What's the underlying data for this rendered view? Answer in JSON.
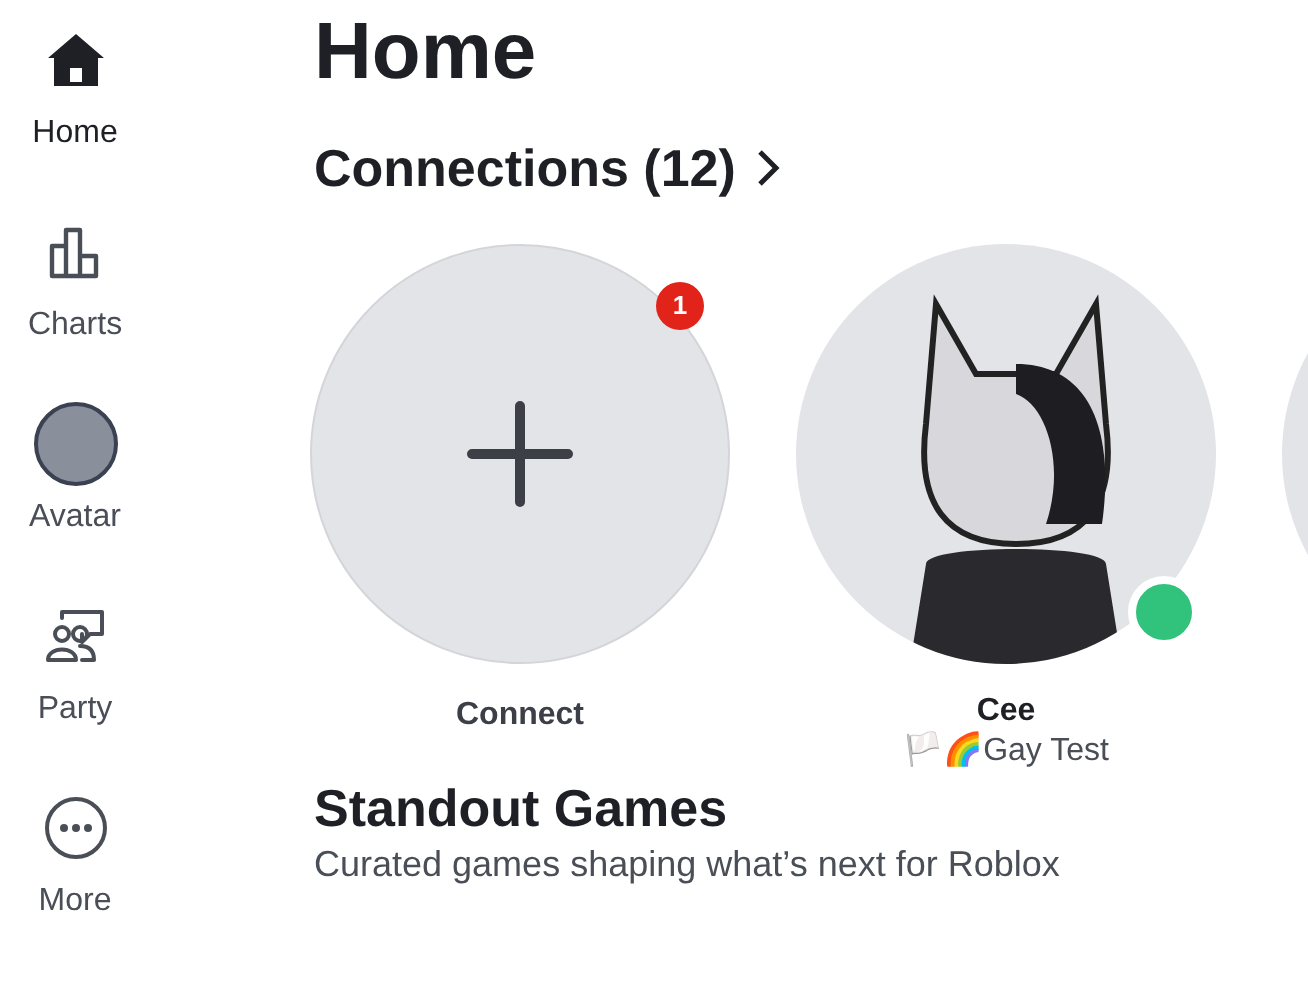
{
  "sidebar": {
    "items": [
      {
        "kind": "home",
        "label": "Home",
        "selected": true
      },
      {
        "kind": "charts",
        "label": "Charts",
        "selected": false
      },
      {
        "kind": "avatar",
        "label": "Avatar",
        "selected": false
      },
      {
        "kind": "party",
        "label": "Party",
        "selected": false
      },
      {
        "kind": "more",
        "label": "More",
        "selected": false
      }
    ]
  },
  "page_title": "Home",
  "connections": {
    "title": "Connections (12)",
    "items": [
      {
        "kind": "connect",
        "name": "Connect",
        "badge": "1"
      },
      {
        "kind": "friend",
        "name": "Cee",
        "status": "🏳️🌈Gay Test",
        "online": true
      },
      {
        "kind": "friend"
      }
    ]
  },
  "standout": {
    "title": "Standout Games",
    "subtitle": "Curated games shaping what’s next for Roblox"
  }
}
